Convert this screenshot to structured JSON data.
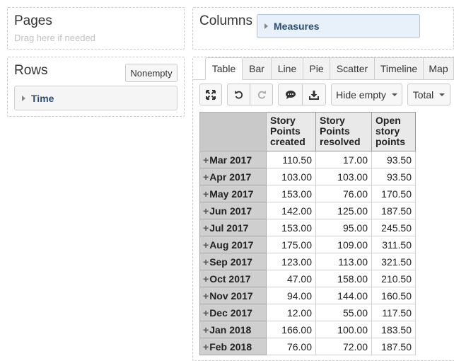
{
  "pages": {
    "title": "Pages",
    "hint": "Drag here if needed"
  },
  "columns": {
    "title": "Columns",
    "measures_label": "Measures"
  },
  "rows": {
    "title": "Rows",
    "nonempty_label": "Nonempty",
    "time_label": "Time"
  },
  "tabs": [
    {
      "label": "Table"
    },
    {
      "label": "Bar"
    },
    {
      "label": "Line"
    },
    {
      "label": "Pie"
    },
    {
      "label": "Scatter"
    },
    {
      "label": "Timeline"
    },
    {
      "label": "Map"
    }
  ],
  "toolbar": {
    "hide_empty_label": "Hide empty",
    "total_label": "Total",
    "icons": [
      "expand-icon",
      "undo-icon",
      "redo-icon",
      "comment-icon",
      "download-icon"
    ]
  },
  "table": {
    "headers": {
      "created": [
        "Story",
        "Points",
        "created"
      ],
      "resolved": [
        "Story",
        "Points",
        "resolved"
      ],
      "open": [
        "Open",
        "story",
        "points"
      ]
    },
    "rows": [
      {
        "label": "Mar 2017",
        "created": "110.50",
        "resolved": "17.00",
        "open": "93.50"
      },
      {
        "label": "Apr 2017",
        "created": "103.00",
        "resolved": "103.00",
        "open": "93.50"
      },
      {
        "label": "May 2017",
        "created": "153.00",
        "resolved": "76.00",
        "open": "170.50"
      },
      {
        "label": "Jun 2017",
        "created": "142.00",
        "resolved": "125.00",
        "open": "187.50"
      },
      {
        "label": "Jul 2017",
        "created": "153.00",
        "resolved": "95.00",
        "open": "245.50"
      },
      {
        "label": "Aug 2017",
        "created": "175.00",
        "resolved": "109.00",
        "open": "311.50"
      },
      {
        "label": "Sep 2017",
        "created": "123.00",
        "resolved": "113.00",
        "open": "321.50"
      },
      {
        "label": "Oct 2017",
        "created": "47.00",
        "resolved": "158.00",
        "open": "210.50"
      },
      {
        "label": "Nov 2017",
        "created": "94.00",
        "resolved": "144.00",
        "open": "160.50"
      },
      {
        "label": "Dec 2017",
        "created": "12.00",
        "resolved": "55.00",
        "open": "117.50"
      },
      {
        "label": "Jan 2018",
        "created": "166.00",
        "resolved": "100.00",
        "open": "183.50"
      },
      {
        "label": "Feb 2018",
        "created": "76.00",
        "resolved": "72.00",
        "open": "187.50"
      }
    ]
  }
}
